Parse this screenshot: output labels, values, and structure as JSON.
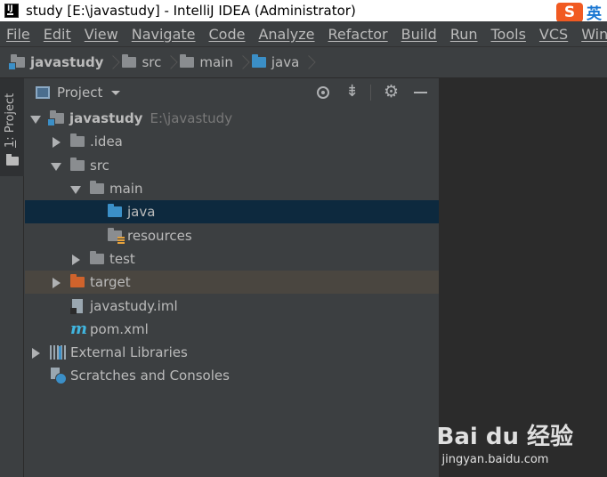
{
  "titlebar": {
    "title": "study [E:\\javastudy] - IntelliJ IDEA (Administrator)",
    "ime_badge": "S",
    "ime_lang": "英"
  },
  "menu": [
    "File",
    "Edit",
    "View",
    "Navigate",
    "Code",
    "Analyze",
    "Refactor",
    "Build",
    "Run",
    "Tools",
    "VCS",
    "Window"
  ],
  "breadcrumb": [
    "javastudy",
    "src",
    "main",
    "java"
  ],
  "sidebar_strip": {
    "tab_number": "1",
    "tab_label": ": Project"
  },
  "project_panel": {
    "title": "Project",
    "tree": [
      {
        "label": "javastudy",
        "path": "E:\\javastudy",
        "icon": "module-folder-icon",
        "expanded": true
      },
      {
        "label": ".idea",
        "icon": "folder-icon",
        "expanded": false
      },
      {
        "label": "src",
        "icon": "folder-icon",
        "expanded": true
      },
      {
        "label": "main",
        "icon": "folder-icon",
        "expanded": true
      },
      {
        "label": "java",
        "icon": "source-folder-icon",
        "selected": true
      },
      {
        "label": "resources",
        "icon": "resources-folder-icon"
      },
      {
        "label": "test",
        "icon": "folder-icon",
        "expanded": false
      },
      {
        "label": "target",
        "icon": "excluded-folder-icon",
        "expanded": false,
        "excluded": true
      },
      {
        "label": "javastudy.iml",
        "icon": "iml-file-icon"
      },
      {
        "label": "pom.xml",
        "icon": "maven-icon"
      },
      {
        "label": "External Libraries",
        "icon": "library-icon",
        "expanded": false
      },
      {
        "label": "Scratches and Consoles",
        "icon": "scratch-icon"
      }
    ]
  },
  "watermark": {
    "logo": "Bai du 经验",
    "url": "jingyan.baidu.com"
  },
  "colors": {
    "background": "#3c3f41",
    "editor": "#2b2b2b",
    "selected_row": "#0d293e",
    "excluded_row": "#4a4640",
    "source_folder": "#3b8fc7",
    "excluded_folder": "#d0632c",
    "text": "#bbbbbb",
    "path_text": "#787878"
  }
}
